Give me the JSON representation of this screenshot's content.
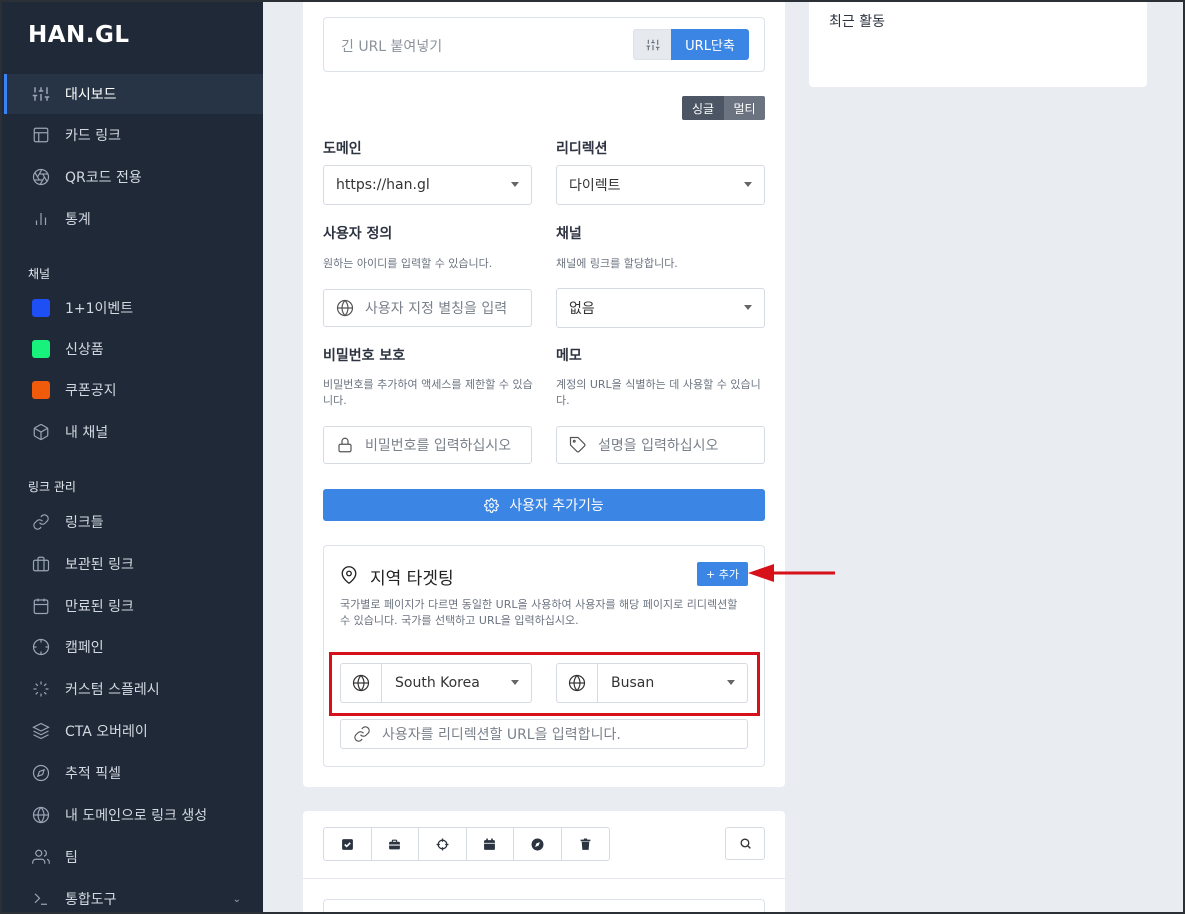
{
  "brand": {
    "logo": "HAN.GL"
  },
  "sidebar": {
    "main": [
      {
        "label": "대시보드",
        "icon": "sliders-icon",
        "active": true
      },
      {
        "label": "카드 링크",
        "icon": "layout-icon"
      },
      {
        "label": "QR코드 전용",
        "icon": "aperture-icon"
      },
      {
        "label": "통계",
        "icon": "bar-chart-icon"
      }
    ],
    "channels_label": "채널",
    "channels": [
      {
        "label": "1+1이벤트",
        "color": "#1e4ff5"
      },
      {
        "label": "신상품",
        "color": "#18f27c"
      },
      {
        "label": "쿠폰공지",
        "color": "#ef5a0b"
      },
      {
        "label": "내 채널",
        "icon": "box-icon"
      }
    ],
    "links_label": "링크 관리",
    "links": [
      {
        "label": "링크들",
        "icon": "link-icon"
      },
      {
        "label": "보관된 링크",
        "icon": "briefcase-icon"
      },
      {
        "label": "만료된 링크",
        "icon": "calendar-icon"
      },
      {
        "label": "캠페인",
        "icon": "crosshair-icon"
      },
      {
        "label": "커스텀 스플레시",
        "icon": "loader-icon"
      },
      {
        "label": "CTA 오버레이",
        "icon": "layers-icon"
      },
      {
        "label": "추적 픽셀",
        "icon": "compass-icon"
      },
      {
        "label": "내 도메인으로 링크 생성",
        "icon": "globe-icon"
      },
      {
        "label": "팀",
        "icon": "users-icon"
      },
      {
        "label": "통합도구",
        "icon": "terminal-icon"
      }
    ]
  },
  "shortener": {
    "placeholder": "긴 URL 붙여넣기",
    "submit_label": "URL단축",
    "mode_single": "싱글",
    "mode_multi": "멀티"
  },
  "form": {
    "domain_label": "도메인",
    "domain_value": "https://han.gl",
    "redirect_label": "리디렉션",
    "redirect_value": "다이렉트",
    "custom_label": "사용자 정의",
    "custom_help": "원하는 아이디를 입력할 수 있습니다.",
    "custom_placeholder": "사용자 지정 별칭을 입력",
    "channel_label": "채널",
    "channel_help": "채널에 링크를 할당합니다.",
    "channel_value": "없음",
    "password_label": "비밀번호 보호",
    "password_help": "비밀번호를 추가하여 액세스를 제한할 수 있습니다.",
    "password_placeholder": "비밀번호를 입력하십시오",
    "memo_label": "메모",
    "memo_help": "계정의 URL을 식별하는 데 사용할 수 있습니다.",
    "memo_placeholder": "설명을 입력하십시오",
    "addon_button": "사용자 추가기능"
  },
  "geo": {
    "title": "지역 타겟팅",
    "add_button": "+ 추가",
    "description": "국가별로 페이지가 다르면 동일한 URL을 사용하여 사용자를 해당 페이지로 리디렉션할 수 있습니다. 국가를 선택하고 URL을 입력하십시오.",
    "country": "South Korea",
    "city": "Busan",
    "url_placeholder": "사용자를 리디렉션할 URL을 입력합니다."
  },
  "recent": {
    "title": "최근 활동"
  },
  "colors": {
    "accent": "#3b86e4",
    "sidebar": "#1f2937",
    "highlight": "#d6111a"
  }
}
